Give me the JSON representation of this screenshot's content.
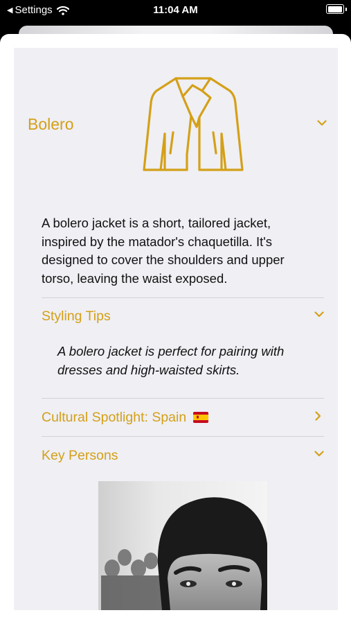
{
  "status_bar": {
    "back_label": "Settings",
    "time": "11:04 AM"
  },
  "item": {
    "title": "Bolero",
    "icon": "jacket-icon",
    "description": "A bolero jacket is a short, tailored jacket, inspired by the matador's chaquetilla. It's designed to cover the shoulders and upper torso, leaving the waist exposed."
  },
  "sections": {
    "styling": {
      "label": "Styling Tips",
      "text": "A bolero jacket is perfect for pairing with dresses and high-waisted skirts."
    },
    "cultural": {
      "label": "Cultural Spotlight: Spain",
      "flag": "spain-flag-icon"
    },
    "key_persons": {
      "label": "Key Persons"
    }
  },
  "colors": {
    "accent": "#d4a017",
    "card_background": "#efeff4"
  }
}
